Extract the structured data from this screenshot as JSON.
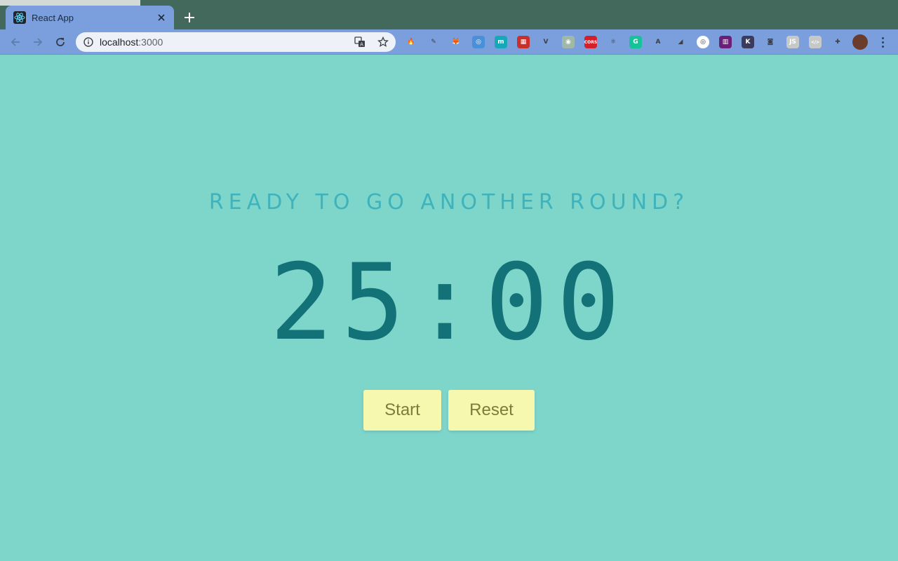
{
  "browser": {
    "tab_title": "React App",
    "url_host": "localhost",
    "url_port": ":3000",
    "extensions": [
      {
        "name": "fire-extension-icon",
        "glyph": "🔥",
        "bg": "transparent"
      },
      {
        "name": "eyedropper-extension-icon",
        "glyph": "✎",
        "bg": "transparent"
      },
      {
        "name": "metamask-extension-icon",
        "glyph": "🦊",
        "bg": "transparent"
      },
      {
        "name": "blue-swirl-extension-icon",
        "glyph": "◎",
        "bg": "#4a90d9"
      },
      {
        "name": "m-extension-icon",
        "glyph": "m",
        "bg": "#17a8b8"
      },
      {
        "name": "red-grid-extension-icon",
        "glyph": "▦",
        "bg": "#c9302c"
      },
      {
        "name": "vue-extension-icon",
        "glyph": "V",
        "bg": "transparent"
      },
      {
        "name": "target-extension-icon",
        "glyph": "◉",
        "bg": "#9fb8a7"
      },
      {
        "name": "cors-extension-icon",
        "glyph": "CORS",
        "bg": "#d4202a"
      },
      {
        "name": "react-devtools-extension-icon",
        "glyph": "⚛",
        "bg": "transparent"
      },
      {
        "name": "grammarly-extension-icon",
        "glyph": "G",
        "bg": "#15c39a"
      },
      {
        "name": "a-circle-extension-icon",
        "glyph": "A",
        "bg": "transparent"
      },
      {
        "name": "ruler-extension-icon",
        "glyph": "◢",
        "bg": "transparent"
      },
      {
        "name": "pink-circle-extension-icon",
        "glyph": "◎",
        "bg": "#ffffff"
      },
      {
        "name": "purple-chart-extension-icon",
        "glyph": "▥",
        "bg": "#6b1f78"
      },
      {
        "name": "k-extension-icon",
        "glyph": "K",
        "bg": "#3b3b5c"
      },
      {
        "name": "link-extension-icon",
        "glyph": "◙",
        "bg": "transparent"
      },
      {
        "name": "js-extension-icon",
        "glyph": "JS",
        "bg": "#c7c9c9"
      },
      {
        "name": "code-extension-icon",
        "glyph": "</>",
        "bg": "#c7c9c9"
      },
      {
        "name": "puzzle-extensions-icon",
        "glyph": "✚",
        "bg": "transparent"
      },
      {
        "name": "profile-avatar",
        "glyph": "",
        "bg": "#6b3b2b"
      }
    ]
  },
  "app": {
    "headline": "READY TO GO ANOTHER ROUND?",
    "timer": "25:00",
    "start_label": "Start",
    "reset_label": "Reset"
  },
  "colors": {
    "page_background": "#7ed6cb",
    "headline": "#3fb3bb",
    "timer": "#137178",
    "button_background": "#f7f8b0",
    "button_text": "#7c7d3a",
    "tab_active": "#7b9fdc",
    "tabstrip": "#42695c"
  }
}
